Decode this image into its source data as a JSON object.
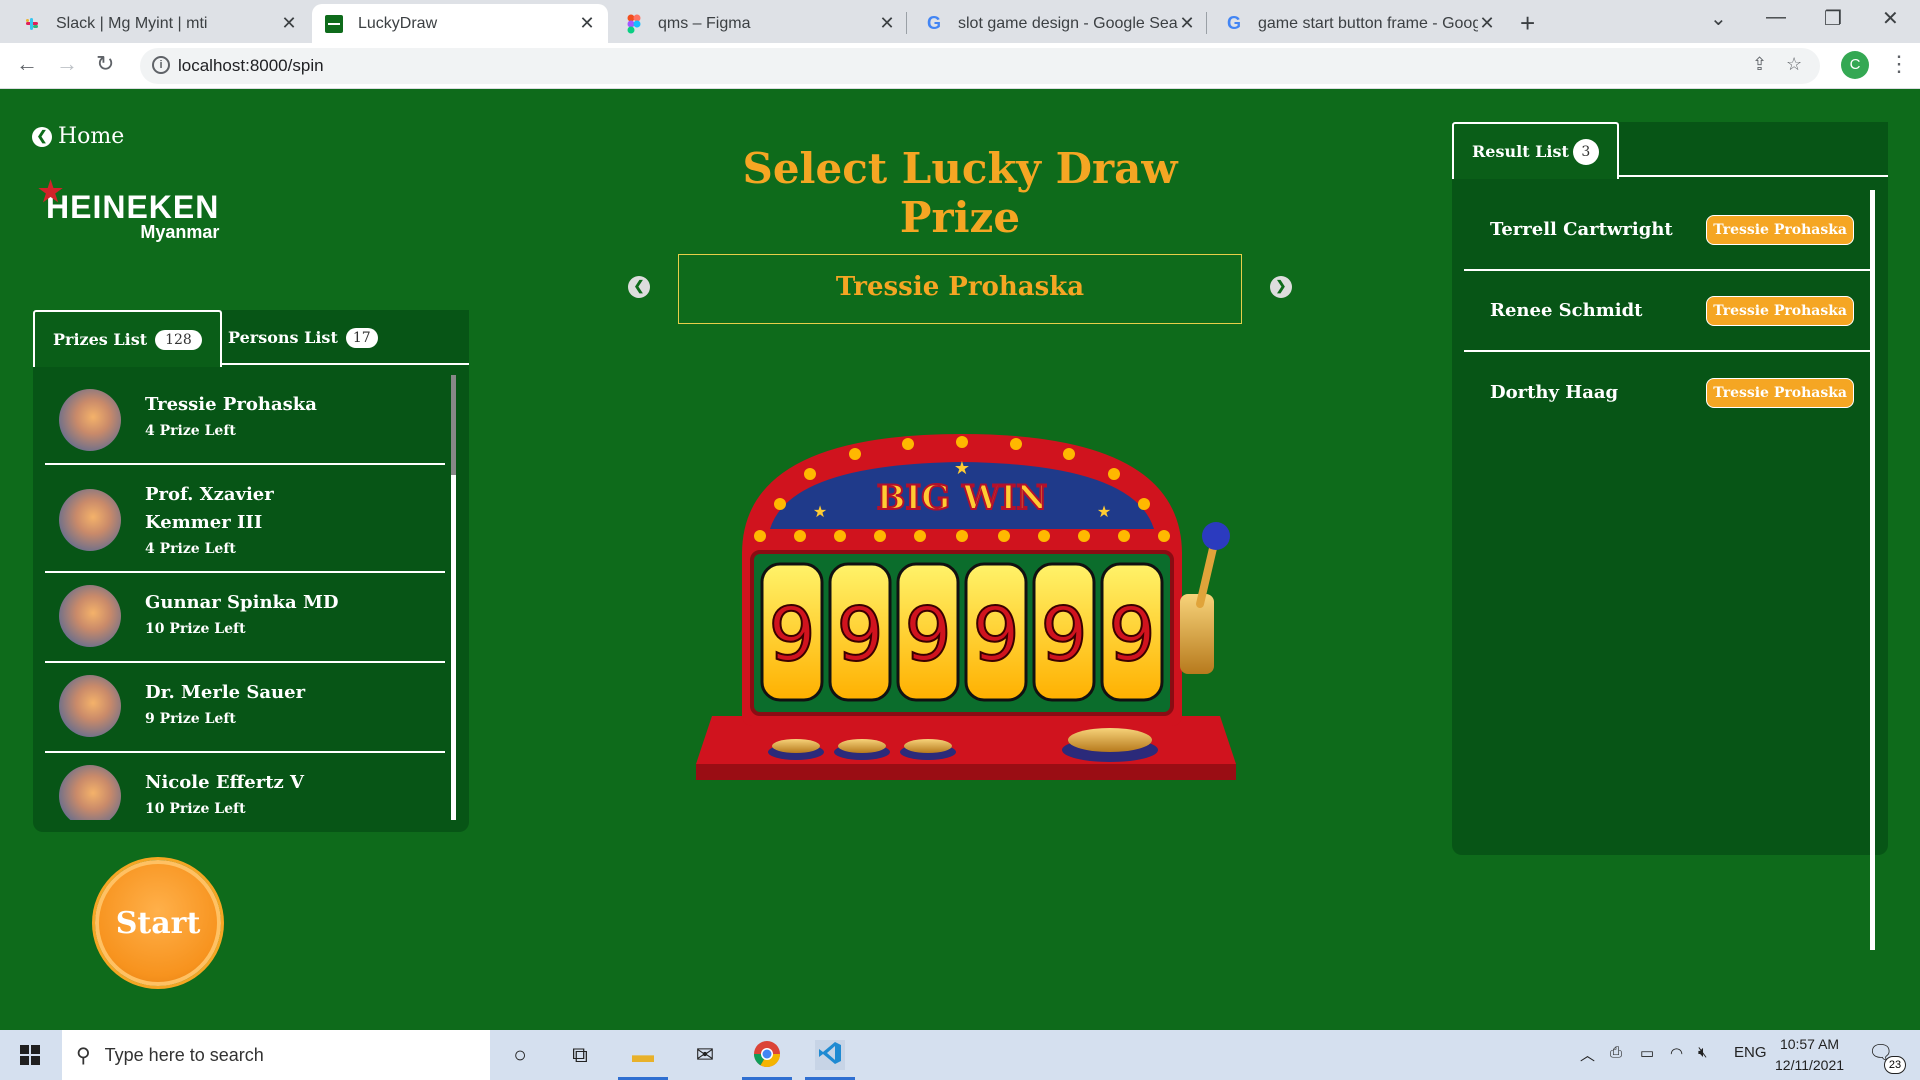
{
  "browser": {
    "tabs": [
      {
        "title": "Slack | Mg Myint | mti",
        "favicon": "slack-icon"
      },
      {
        "title": "LuckyDraw",
        "favicon": "heineken-icon"
      },
      {
        "title": "qms – Figma",
        "favicon": "figma-icon"
      },
      {
        "title": "slot game design - Google Searc",
        "favicon": "google-icon"
      },
      {
        "title": "game start button frame - Googl",
        "favicon": "google-icon"
      }
    ],
    "url": "localhost:8000/spin",
    "profile_initial": "C"
  },
  "app": {
    "home_label": "Home",
    "logo_brand": "HEINEKEN",
    "logo_sub": "Myanmar",
    "heading": "Select Lucky Draw Prize",
    "selected_prize": "Tressie Prohaska",
    "start_label": "Start",
    "slot": {
      "banner": "BIG WIN",
      "digits": [
        "9",
        "9",
        "9",
        "9",
        "9",
        "9"
      ]
    },
    "left_tabs": [
      {
        "label": "Prizes List",
        "count": "128"
      },
      {
        "label": "Persons List",
        "count": "17"
      }
    ],
    "prizes": [
      {
        "name": "Tressie Prohaska",
        "left": "4 Prize Left"
      },
      {
        "name": "Prof. Xzavier Kemmer III",
        "left": "4 Prize Left"
      },
      {
        "name": "Gunnar Spinka MD",
        "left": "10 Prize Left"
      },
      {
        "name": "Dr. Merle Sauer",
        "left": "9 Prize Left"
      },
      {
        "name": "Nicole Effertz V",
        "left": "10 Prize Left"
      }
    ],
    "result_tab": {
      "label": "Result List",
      "count": "3"
    },
    "results": [
      {
        "name": "Terrell Cartwright",
        "prize": "Tressie Prohaska"
      },
      {
        "name": "Renee Schmidt",
        "prize": "Tressie Prohaska"
      },
      {
        "name": "Dorthy Haag",
        "prize": "Tressie Prohaska"
      }
    ],
    "colors": {
      "background": "#0e6b1b",
      "panel": "#075516",
      "accent": "#f5a623"
    }
  },
  "taskbar": {
    "search_placeholder": "Type here to search",
    "language": "ENG",
    "time": "10:57 AM",
    "date": "12/11/2021",
    "notifications": "23"
  }
}
